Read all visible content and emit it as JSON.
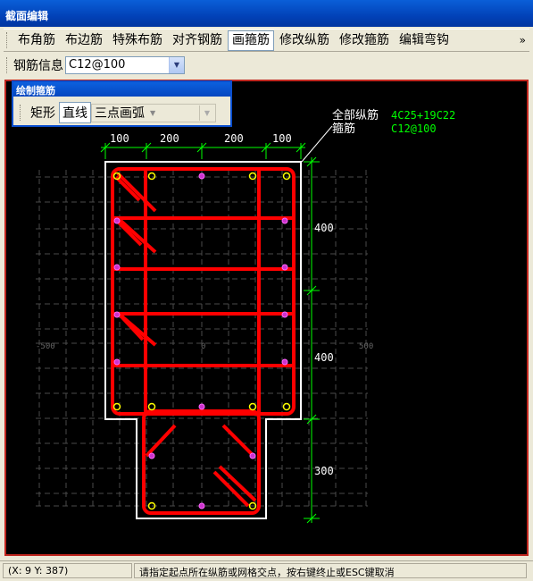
{
  "window": {
    "title": "截面编辑"
  },
  "toolbar": {
    "items": [
      {
        "label": "布角筋",
        "active": false
      },
      {
        "label": "布边筋",
        "active": false
      },
      {
        "label": "特殊布筋",
        "active": false
      },
      {
        "label": "对齐钢筋",
        "active": false
      },
      {
        "label": "画箍筋",
        "active": true
      },
      {
        "label": "修改纵筋",
        "active": false
      },
      {
        "label": "修改箍筋",
        "active": false
      },
      {
        "label": "编辑弯钩",
        "active": false
      }
    ],
    "more": "»"
  },
  "rebar_info": {
    "label": "钢筋信息",
    "value": "C12@100"
  },
  "draw_panel": {
    "title": "绘制箍筋",
    "buttons": [
      {
        "label": "矩形",
        "active": false
      },
      {
        "label": "直线",
        "active": true
      }
    ],
    "arc_mode": "三点画弧"
  },
  "drawing": {
    "legend": {
      "all_rebar_label": "全部纵筋",
      "all_rebar_value": "4C25+19C22",
      "stirrup_label": "箍筋",
      "stirrup_value": "C12@100"
    },
    "dims_top": [
      "100",
      "200",
      "200",
      "100"
    ],
    "dims_right": [
      "400",
      "400",
      "300"
    ],
    "axis_left": "-500",
    "axis_right": "500",
    "axis_center": "0"
  },
  "status": {
    "coords": "(X: 9 Y: 387)",
    "message": "请指定起点所在纵筋或网格交点，按右键终止或ESC键取消"
  },
  "colors": {
    "stirrup": "#ff0000",
    "outline": "#ffffff",
    "dimension": "#00ff00",
    "corner_bar": "#ffff00",
    "side_bar": "#cc33cc",
    "grid": "#4a4a4a"
  }
}
